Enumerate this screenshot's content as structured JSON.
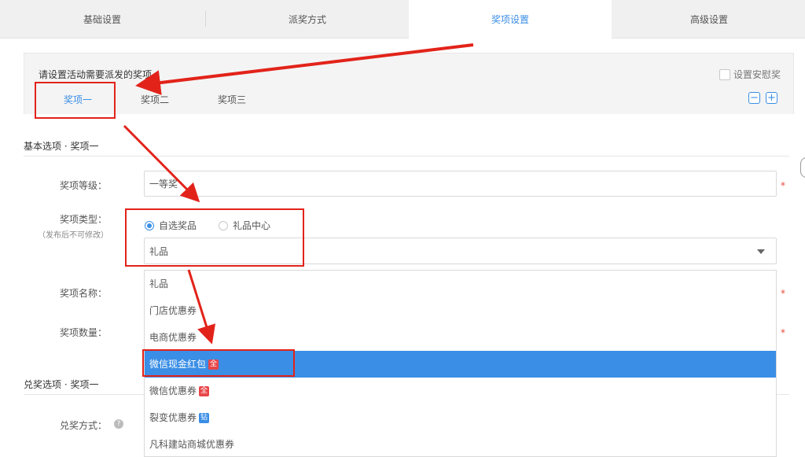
{
  "top_tabs": [
    "基础设置",
    "派奖方式",
    "奖项设置",
    "高级设置"
  ],
  "active_top_tab": "奖项设置",
  "panel": {
    "title": "请设置活动需要派发的奖项",
    "checkbox_label": "设置安慰奖",
    "prize_tabs": [
      "奖项一",
      "奖项二",
      "奖项三"
    ],
    "minus": "−",
    "plus": "+"
  },
  "basic_section": {
    "title": "基本选项 · 奖项一",
    "level_label": "奖项等级：",
    "level_value": "一等奖",
    "type_label": "奖项类型：",
    "type_note": "（发布后不可修改）",
    "radio_options": [
      "自选奖品",
      "礼品中心"
    ],
    "selected_radio": "自选奖品",
    "select_value": "礼品",
    "name_label": "奖项名称：",
    "qty_label": "奖项数量：",
    "required_mark": "*"
  },
  "dropdown": {
    "options": [
      {
        "label": "礼品",
        "badge": ""
      },
      {
        "label": "门店优惠券",
        "badge": ""
      },
      {
        "label": "电商优惠券",
        "badge": ""
      },
      {
        "label": "微信现金红包",
        "badge": "全"
      },
      {
        "label": "微信优惠券",
        "badge": "全"
      },
      {
        "label": "裂变优惠券",
        "badge": "钻"
      },
      {
        "label": "凡科建站商城优惠券",
        "badge": ""
      }
    ],
    "selected": "微信现金红包"
  },
  "redeem_section": {
    "title": "兑奖选项 · 奖项一",
    "method_label": "兑奖方式：",
    "help_icon": "?"
  },
  "colors": {
    "accent": "#3a8ee6",
    "badge_red": "#e8474a",
    "badge_blue": "#3a8ee6",
    "annotation_red": "#e2231a"
  }
}
